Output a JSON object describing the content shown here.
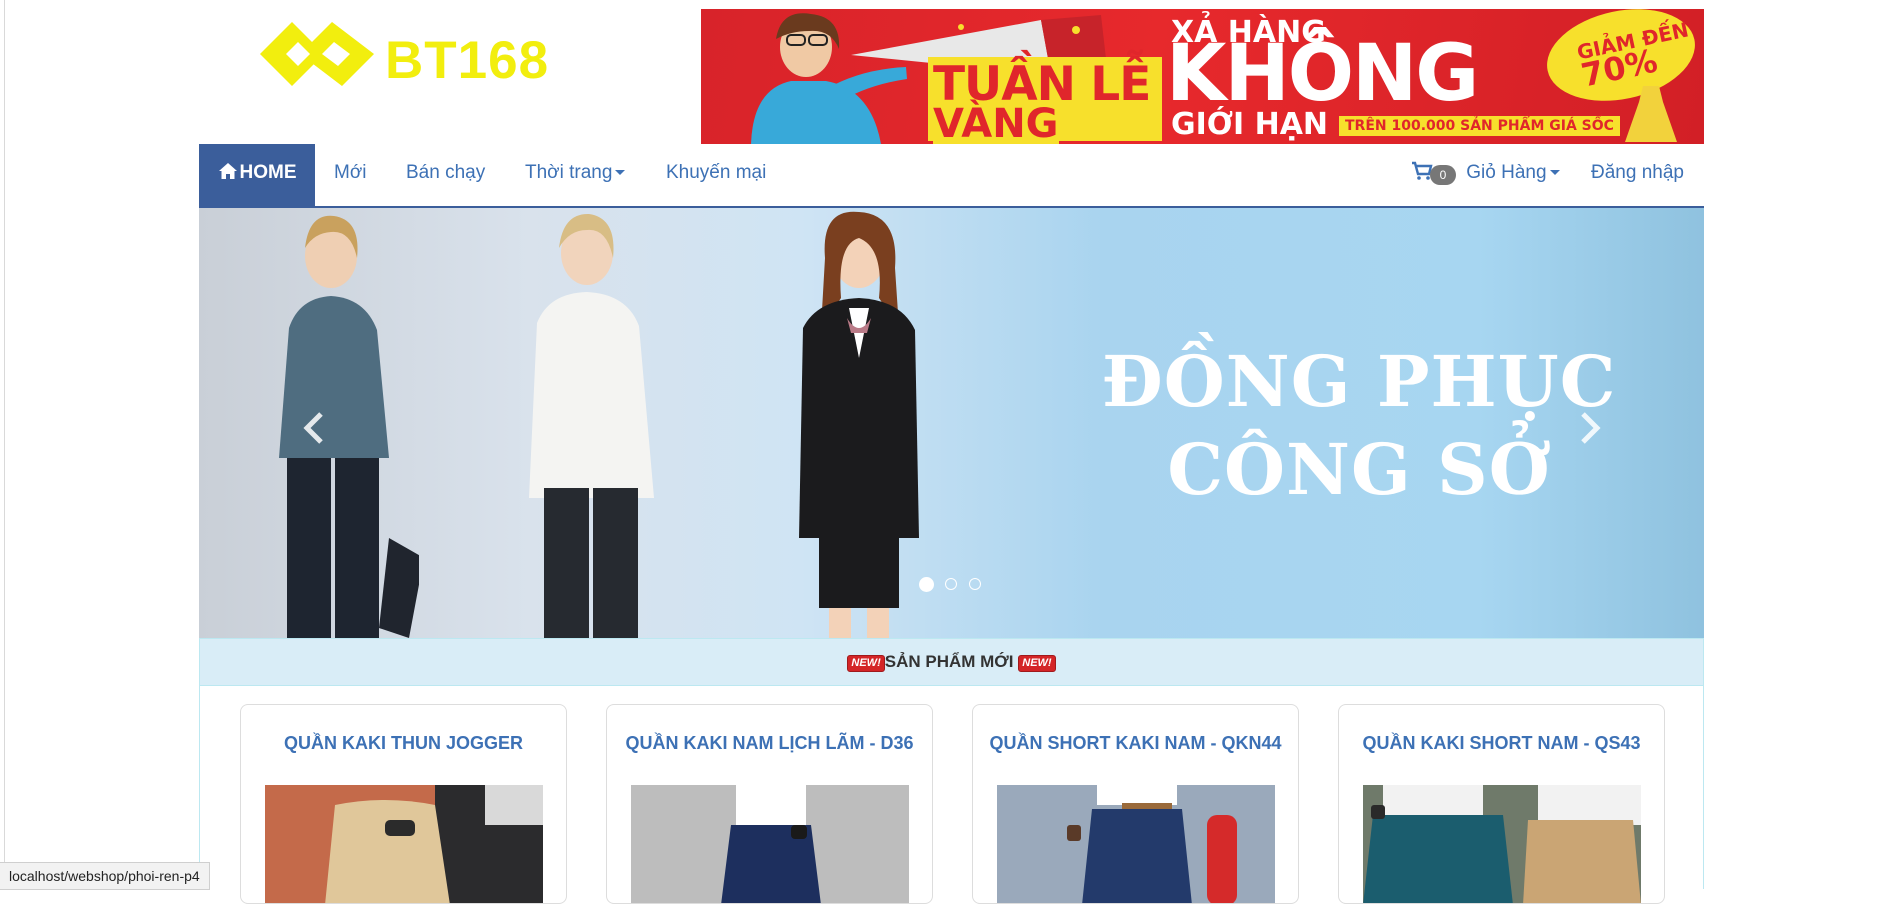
{
  "logo": {
    "text": "BT168"
  },
  "banner": {
    "line_tuan": "TUẦN LỄ",
    "line_vang": "VÀNG",
    "line_xa": "XẢ HÀNG",
    "line_khong": "KHÔNG",
    "line_gioi": "GIỚI HẠN",
    "line_tren": "TRÊN 100.000 SẢN PHẨM GIÁ SỐC",
    "badge_l1": "GIẢM ĐẾN",
    "badge_l2": "70%"
  },
  "nav": {
    "home": "HOME",
    "moi": "Mới",
    "ban_chay": "Bán chạy",
    "thoi_trang": "Thời trang",
    "khuyen_mai": "Khuyến mại",
    "cart_count": "0",
    "gio_hang": "Giỏ Hàng",
    "dang_nhap": "Đăng nhập"
  },
  "carousel": {
    "line1": "ĐỒNG PHỤC",
    "line2": "CÔNG SỞ",
    "slide_count": 3,
    "active_slide": 1
  },
  "section": {
    "badge": "NEW!",
    "title": "SẢN PHẨM MỚI"
  },
  "products": [
    {
      "name": "QUẦN KAKI THUN JOGGER"
    },
    {
      "name": "QUẦN KAKI NAM LỊCH LÃM - D36"
    },
    {
      "name": "QUẦN SHORT KAKI NAM - QKN44"
    },
    {
      "name": "QUẦN KAKI SHORT NAM - QS43"
    }
  ],
  "status": {
    "url": "localhost/webshop/phoi-ren-p4"
  },
  "colors": {
    "logo_yellow": "#f2ee0e",
    "nav_active": "#3b5e9b",
    "link_blue": "#3d71b5",
    "banner_red": "#e0262b",
    "section_bg": "#d9edf7"
  }
}
